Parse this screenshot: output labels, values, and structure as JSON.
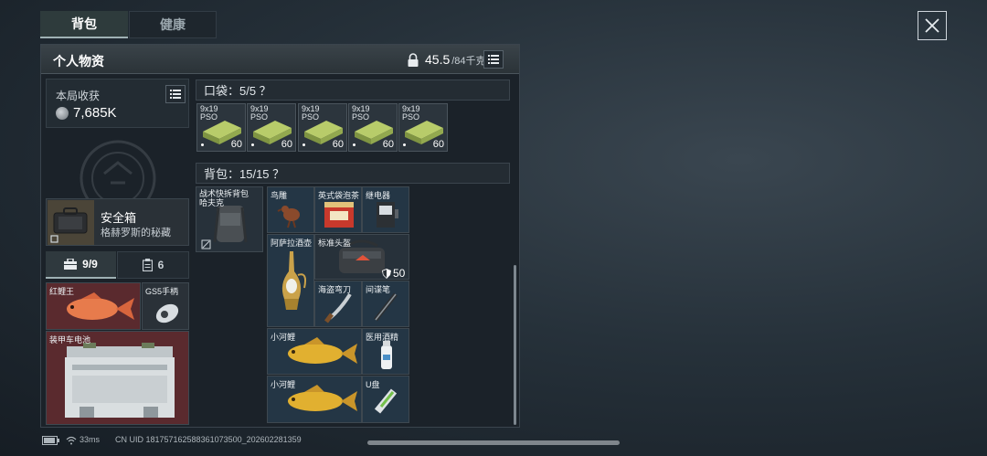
{
  "tabs": {
    "backpack": "背包",
    "health": "健康"
  },
  "panel": {
    "title": "个人物资",
    "weight_current": "45.5",
    "weight_capacity": "/84千克"
  },
  "earnings": {
    "label": "本局收获",
    "value": "7,685K"
  },
  "safe_box": {
    "title": "安全箱",
    "subtitle": "格赫罗斯的秘藏"
  },
  "container_tabs": {
    "toolbox_count": "9/9",
    "clipboard_count": "6"
  },
  "safe_items": [
    {
      "label": "红鲤王"
    },
    {
      "label": "GS5手柄"
    },
    {
      "label": "装甲车电池"
    }
  ],
  "pocket": {
    "header": "口袋：5/5 ？",
    "items": [
      {
        "label_line1": "9x19",
        "label_line2": "PSO",
        "qty": "60"
      },
      {
        "label_line1": "9x19",
        "label_line2": "PSO",
        "qty": "60"
      },
      {
        "label_line1": "9x19",
        "label_line2": "PSO",
        "qty": "60"
      },
      {
        "label_line1": "9x19",
        "label_line2": "PSO",
        "qty": "60"
      },
      {
        "label_line1": "9x19",
        "label_line2": "PSO",
        "qty": "60"
      }
    ]
  },
  "backpack": {
    "header": "背包：15/15 ？",
    "bag_label_line1": "战术快拆背包",
    "bag_label_line2": "哈夫克",
    "items": {
      "bird": "鸟雕",
      "tea": "英式袋泡茶",
      "relay": "继电器",
      "pot": "阿萨拉酒壶",
      "helmet_bag": "标准头盔",
      "helmet_qty": "50",
      "knife": "海盗弯刀",
      "pen": "间谍笔",
      "carp1": "小河鲤",
      "alcohol": "医用酒精",
      "carp2": "小河鲤",
      "usb": "U盘"
    }
  },
  "status_bar": {
    "ping": "33ms",
    "uid": "CN UID 18175716258836107350​0_202602281359"
  }
}
